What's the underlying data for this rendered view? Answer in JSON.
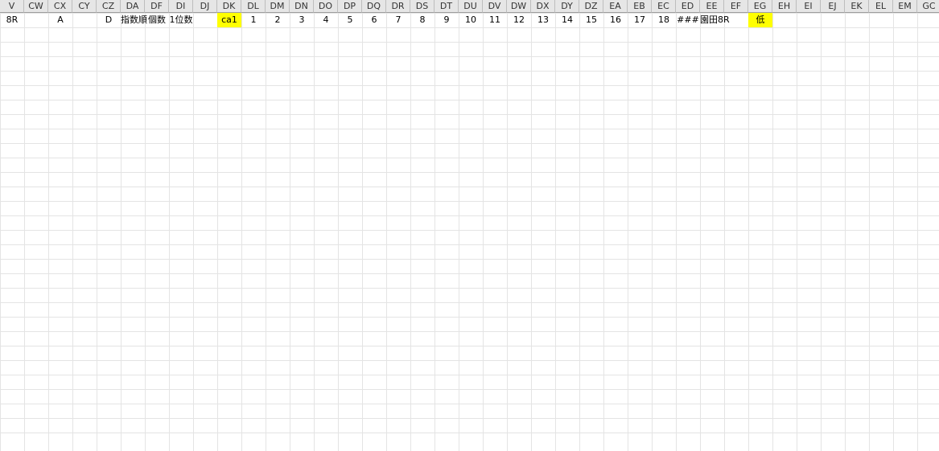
{
  "sheet": {
    "column_headers": [
      "V",
      "CW",
      "CX",
      "CY",
      "CZ",
      "DA",
      "DF",
      "DI",
      "DJ",
      "DK",
      "DL",
      "DM",
      "DN",
      "DO",
      "DP",
      "DQ",
      "DR",
      "DS",
      "DT",
      "DU",
      "DV",
      "DW",
      "DX",
      "DY",
      "DZ",
      "EA",
      "EB",
      "EC",
      "ED",
      "EE",
      "EF",
      "EG",
      "EH",
      "EI",
      "EJ",
      "EK",
      "EL",
      "EM",
      "GC"
    ],
    "colors": {
      "yellow": "#ffff00",
      "pink": "#ffc0cb",
      "lavender": "#ffccff",
      "orange": "#f8a400",
      "peach": "#fbd5b5",
      "cyan": "#00e0e0",
      "light_blue": "#cde9f2",
      "light_green": "#c6efce",
      "red_highlight": "#e03030",
      "blue_highlight": "#4060c0",
      "selection": "#217346"
    },
    "rows": [
      {
        "label": "",
        "cells": [
          "8R",
          "",
          "A",
          "",
          "D",
          "指数順",
          "個数",
          "1位数",
          "",
          "ca1",
          "1",
          "2",
          "3",
          "4",
          "5",
          "6",
          "7",
          "8",
          "9",
          "10",
          "11",
          "12",
          "13",
          "14",
          "15",
          "16",
          "17",
          "18",
          "###",
          "園田8R",
          "",
          "低"
        ]
      }
    ]
  }
}
